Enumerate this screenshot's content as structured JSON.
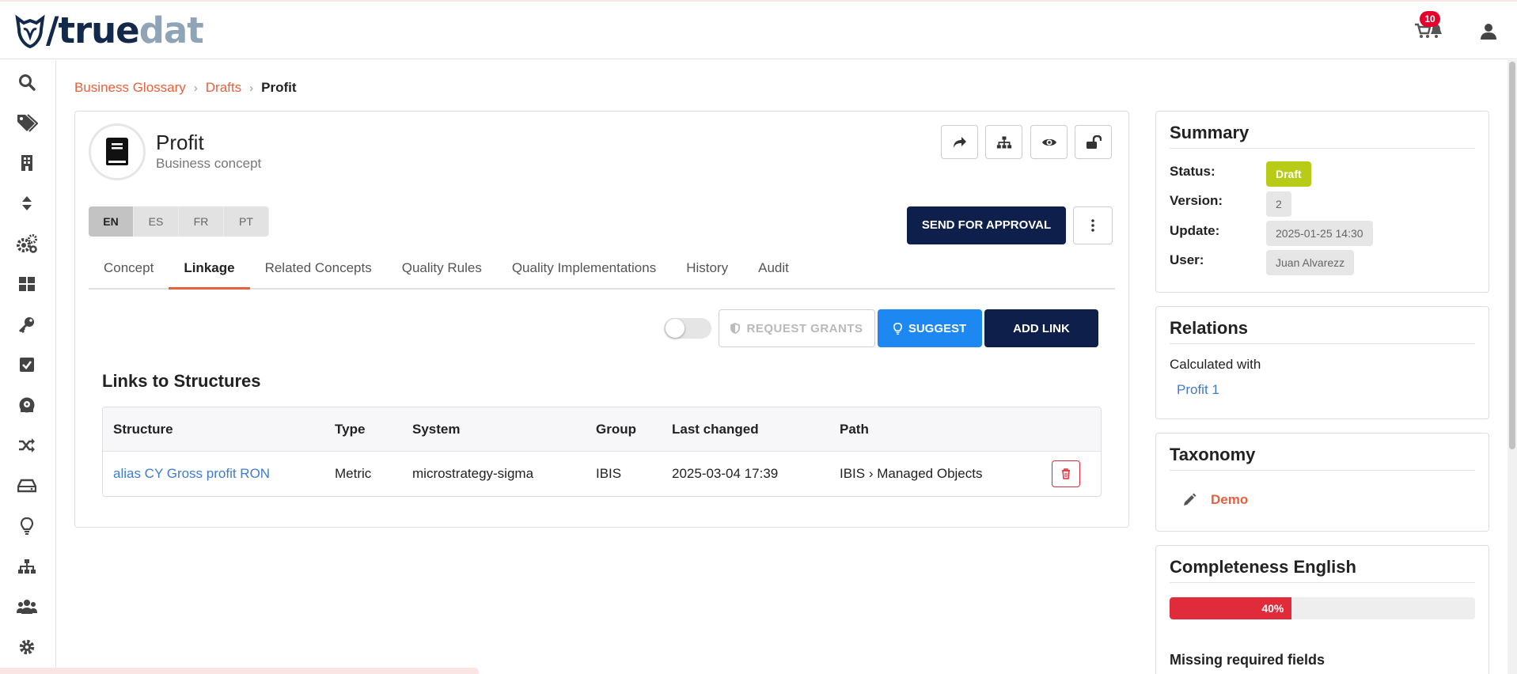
{
  "app": {
    "logo_prefix": "/",
    "logo_part1": "true",
    "logo_part2": "dat",
    "notification_count": "10"
  },
  "breadcrumb": {
    "items": [
      "Business Glossary",
      "Drafts"
    ],
    "current": "Profit",
    "separator": "›"
  },
  "concept": {
    "title": "Profit",
    "subtitle": "Business concept",
    "languages": [
      "EN",
      "ES",
      "FR",
      "PT"
    ],
    "send_label": "SEND FOR APPROVAL"
  },
  "tabs": [
    "Concept",
    "Linkage",
    "Related Concepts",
    "Quality Rules",
    "Quality Implementations",
    "History",
    "Audit"
  ],
  "active_tab": "Linkage",
  "linkage": {
    "request_grants_label": "REQUEST GRANTS",
    "suggest_label": "SUGGEST",
    "add_link_label": "ADD LINK",
    "section_title": "Links to Structures",
    "columns": [
      "Structure",
      "Type",
      "System",
      "Group",
      "Last changed",
      "Path"
    ],
    "rows": [
      {
        "structure": "alias CY Gross profit RON",
        "type": "Metric",
        "system": "microstrategy-sigma",
        "group": "IBIS",
        "last_changed": "2025-03-04 17:39",
        "path": "IBIS › Managed Objects"
      }
    ]
  },
  "summary": {
    "title": "Summary",
    "status_label": "Status:",
    "status_value": "Draft",
    "version_label": "Version:",
    "version_value": "2",
    "update_label": "Update:",
    "update_value": "2025-01-25 14:30",
    "user_label": "User:",
    "user_value": "Juan Alvarezz"
  },
  "relations": {
    "title": "Relations",
    "group_label": "Calculated with",
    "link": "Profit 1"
  },
  "taxonomy": {
    "title": "Taxonomy",
    "domain": "Demo"
  },
  "completeness": {
    "title": "Completeness English",
    "percent_label": "40%",
    "percent": 40,
    "missing_title": "Missing required fields"
  },
  "colors": {
    "brand_navy": "#0e1f4b",
    "accent_orange": "#e8603c",
    "link_blue": "#3e7bd1",
    "suggest_blue": "#1e88f2",
    "draft_green": "#b7cb17",
    "danger_red": "#e02b3a"
  },
  "icons": {
    "sidebar": [
      "search-icon",
      "tags-icon",
      "building-icon",
      "sort-icon",
      "cogs-icon",
      "dashboard-icon",
      "key-icon",
      "check-square-icon",
      "disk-icon",
      "shuffle-icon",
      "drive-icon",
      "lightbulb-icon",
      "sitemap-icon",
      "users-icon",
      "gear-icon"
    ],
    "header_actions": [
      "share-icon",
      "sitemap-icon",
      "eye-icon",
      "unlock-icon"
    ]
  }
}
